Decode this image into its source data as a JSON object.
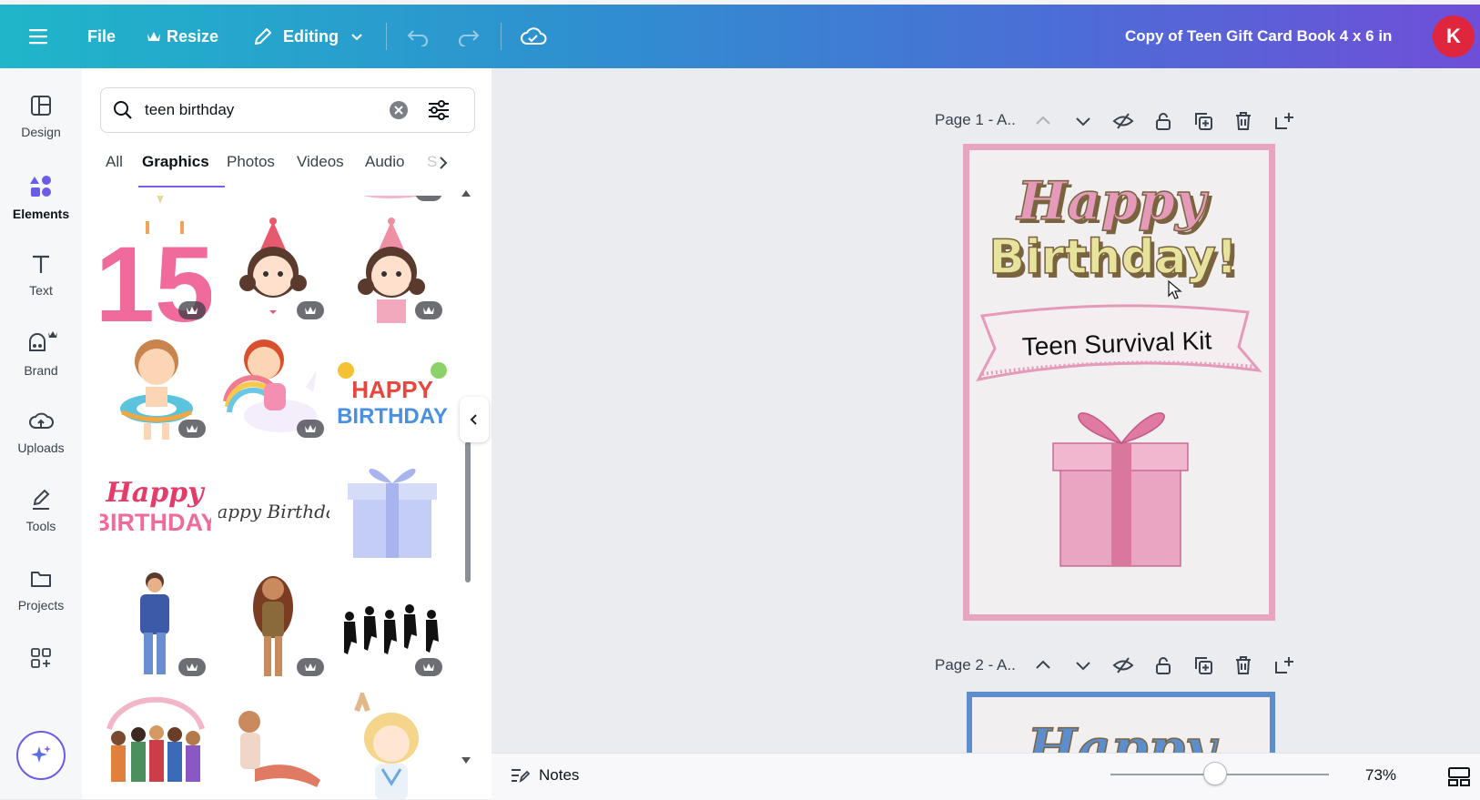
{
  "topbar": {
    "menu_icon": "hamburger-icon",
    "file_label": "File",
    "resize_label": "Resize",
    "editing_label": "Editing",
    "doc_title": "Copy of Teen Gift Card Book 4 x 6 in",
    "avatar_letter": "K",
    "colors": {
      "gradient_start": "#1fb6c9",
      "gradient_end": "#6f4fd8",
      "avatar": "#e0263e"
    }
  },
  "rail": {
    "items": [
      {
        "label": "Design",
        "icon": "design-icon"
      },
      {
        "label": "Elements",
        "icon": "elements-icon"
      },
      {
        "label": "Text",
        "icon": "text-icon"
      },
      {
        "label": "Brand",
        "icon": "brand-icon"
      },
      {
        "label": "Uploads",
        "icon": "uploads-icon"
      },
      {
        "label": "Tools",
        "icon": "tools-icon"
      },
      {
        "label": "Projects",
        "icon": "projects-icon"
      }
    ],
    "active": "Elements"
  },
  "panel": {
    "search_value": "teen birthday",
    "tabs": [
      "All",
      "Graphics",
      "Photos",
      "Videos",
      "Audio",
      "S"
    ],
    "active_tab": "Graphics",
    "graphics": {
      "happy_birthday_script": "Happy Birthday",
      "happy_birthday_bold": [
        "Happy",
        "BIRTHDAY"
      ],
      "happy_birthday_balloons": [
        "HAPPY",
        "BIRTHDAY"
      ],
      "number_candle": "15"
    }
  },
  "canvas": {
    "page1_label": "Page 1 - A..",
    "page2_label": "Page 2 - A..",
    "card_heading_1": "Happy",
    "card_heading_2": "Birthday!",
    "card_banner_text": "Teen Survival Kit",
    "page2_heading": "Happy",
    "colors": {
      "card1_border": "#e6a6c0",
      "card2_border": "#5d8ecb",
      "pink": "#e59ab9",
      "yellow": "#e8e39c"
    }
  },
  "bottombar": {
    "notes_label": "Notes",
    "zoom_value": "73%",
    "zoom_fraction": 0.5
  }
}
